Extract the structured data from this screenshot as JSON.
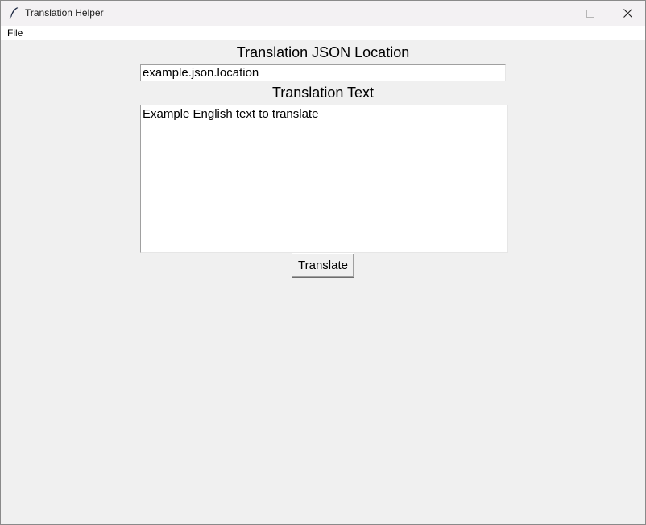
{
  "window": {
    "title": "Translation Helper",
    "controls": {
      "minimize_icon": "minimize-icon",
      "maximize_icon": "maximize-icon",
      "close_icon": "close-icon"
    }
  },
  "menubar": {
    "items": [
      {
        "label": "File"
      }
    ]
  },
  "form": {
    "json_location": {
      "label": "Translation JSON Location",
      "value": "example.json.location"
    },
    "translation_text": {
      "label": "Translation Text",
      "value": "Example English text to translate"
    },
    "translate_button": {
      "label": "Translate"
    }
  },
  "colors": {
    "window_bg": "#f0f0f0",
    "titlebar_bg": "#f3f1f3",
    "field_bg": "#ffffff"
  }
}
